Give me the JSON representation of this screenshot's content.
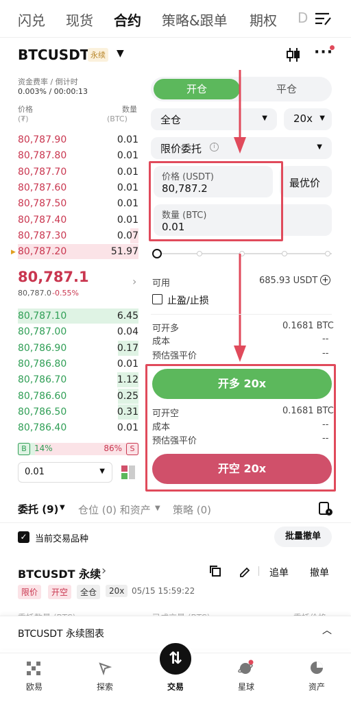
{
  "top_tabs": [
    "闪兑",
    "现货",
    "合约",
    "策略&跟单",
    "期权",
    "D"
  ],
  "symbol": {
    "name": "BTCUSDT",
    "badge": "永续"
  },
  "funding": {
    "label": "资金费率 / 倒计时",
    "value": "0.003% / 00:00:13"
  },
  "book_headers": {
    "price": "价格",
    "price_unit": "(₮)",
    "qty": "数量",
    "qty_unit": "(BTC)"
  },
  "asks": [
    {
      "price": "80,787.90",
      "qty": "0.01"
    },
    {
      "price": "80,787.80",
      "qty": "0.01"
    },
    {
      "price": "80,787.70",
      "qty": "0.01"
    },
    {
      "price": "80,787.60",
      "qty": "0.01"
    },
    {
      "price": "80,787.50",
      "qty": "0.01"
    },
    {
      "price": "80,787.40",
      "qty": "0.01"
    },
    {
      "price": "80,787.30",
      "qty": "0.07"
    },
    {
      "price": "80,787.20",
      "qty": "51.97"
    }
  ],
  "last_price": {
    "value": "80,787.1",
    "mark": "80,787.0",
    "change": "-0.55%"
  },
  "bids": [
    {
      "price": "80,787.10",
      "qty": "6.45"
    },
    {
      "price": "80,787.00",
      "qty": "0.04"
    },
    {
      "price": "80,786.90",
      "qty": "0.17"
    },
    {
      "price": "80,786.80",
      "qty": "0.01"
    },
    {
      "price": "80,786.70",
      "qty": "1.12"
    },
    {
      "price": "80,786.60",
      "qty": "0.25"
    },
    {
      "price": "80,786.50",
      "qty": "0.31"
    },
    {
      "price": "80,786.40",
      "qty": "0.01"
    }
  ],
  "ratio": {
    "b_label": "B",
    "b_pct": "14%",
    "s_pct": "86%",
    "s_label": "S",
    "b_fraction": 0.14
  },
  "depth_select": "0.01",
  "mode_tabs": {
    "open": "开仓",
    "close": "平仓"
  },
  "margin_mode": "全仓",
  "leverage": "20x",
  "order_type": "限价委托",
  "price_field": {
    "label": "价格 (USDT)",
    "value": "80,787.2",
    "best": "最优价"
  },
  "qty_field": {
    "label": "数量 (BTC)",
    "value": "0.01"
  },
  "slider_fraction": 0,
  "available": {
    "label": "可用",
    "value": "685.93 USDT"
  },
  "tpsl_label": "止盈/止损",
  "long_info": {
    "can_open_label": "可开多",
    "can_open": "0.1681 BTC",
    "cost_label": "成本",
    "cost": "--",
    "liq_label": "预估强平价",
    "liq": "--"
  },
  "long_btn": "开多 20x",
  "short_info": {
    "can_open_label": "可开空",
    "can_open": "0.1681 BTC",
    "cost_label": "成本",
    "cost": "--",
    "liq_label": "预估强平价",
    "liq": "--"
  },
  "short_btn": "开空 20x",
  "orders_tabs": {
    "entrust": "委托 (9)",
    "positions": "仓位 (0) 和资产",
    "strategy": "策略 (0)"
  },
  "current_only": "当前交易品种",
  "cancel_all": "批量撤单",
  "order": {
    "symbol": "BTCUSDT 永续",
    "add": "追单",
    "cancel": "撤单",
    "tags": [
      "限价",
      "开空",
      "全仓",
      "20x"
    ],
    "time": "05/15 15:59:22",
    "col1": "委托数量 (BTC)",
    "col2": "已成交量 (BTC)",
    "col3": "委托价格"
  },
  "chart_bar": "BTCUSDT 永续图表",
  "bottom_nav": [
    "欧易",
    "探索",
    "交易",
    "星球",
    "资产"
  ],
  "colors": {
    "accent_green": "#5cb85c",
    "sell_red": "#d0506a",
    "highlight": "#e04a5b"
  }
}
